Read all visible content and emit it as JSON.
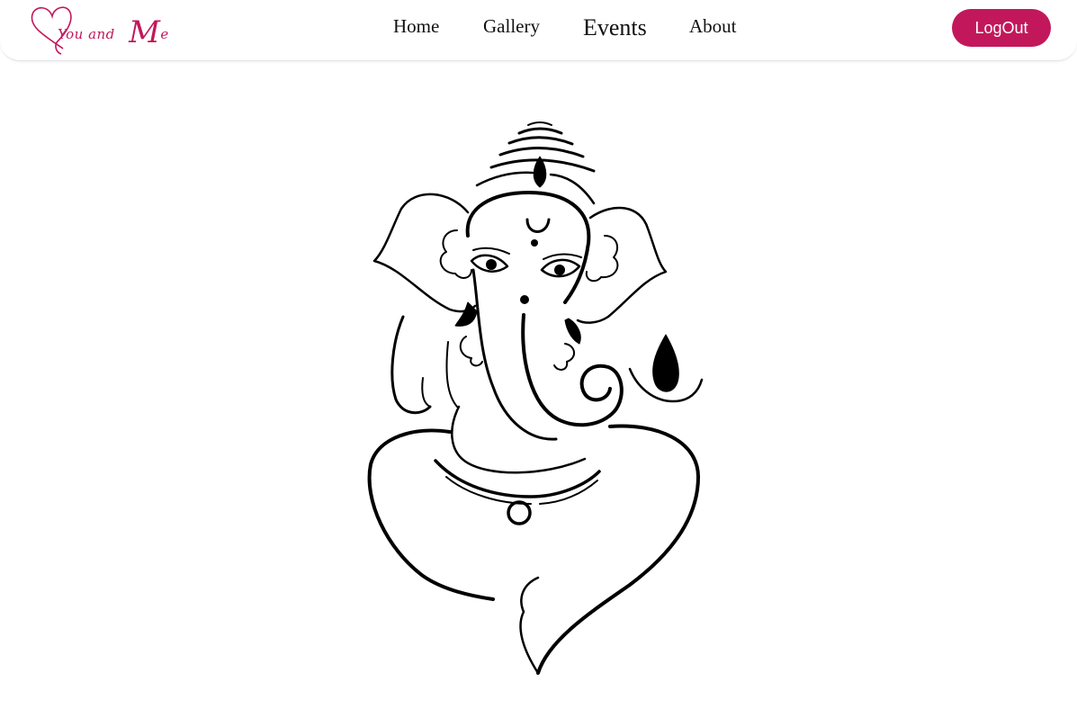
{
  "brand": {
    "logo_word_1": "You",
    "logo_word_2": "and",
    "logo_letter_m": "M",
    "logo_letter_e": "e",
    "color": "#c2185b"
  },
  "nav": {
    "items": [
      {
        "label": "Home"
      },
      {
        "label": "Gallery"
      },
      {
        "label": "Events",
        "active": true
      },
      {
        "label": "About"
      }
    ]
  },
  "auth": {
    "logout_label": "LogOut"
  },
  "hero": {
    "icon": "ganesha-line-art-icon"
  }
}
